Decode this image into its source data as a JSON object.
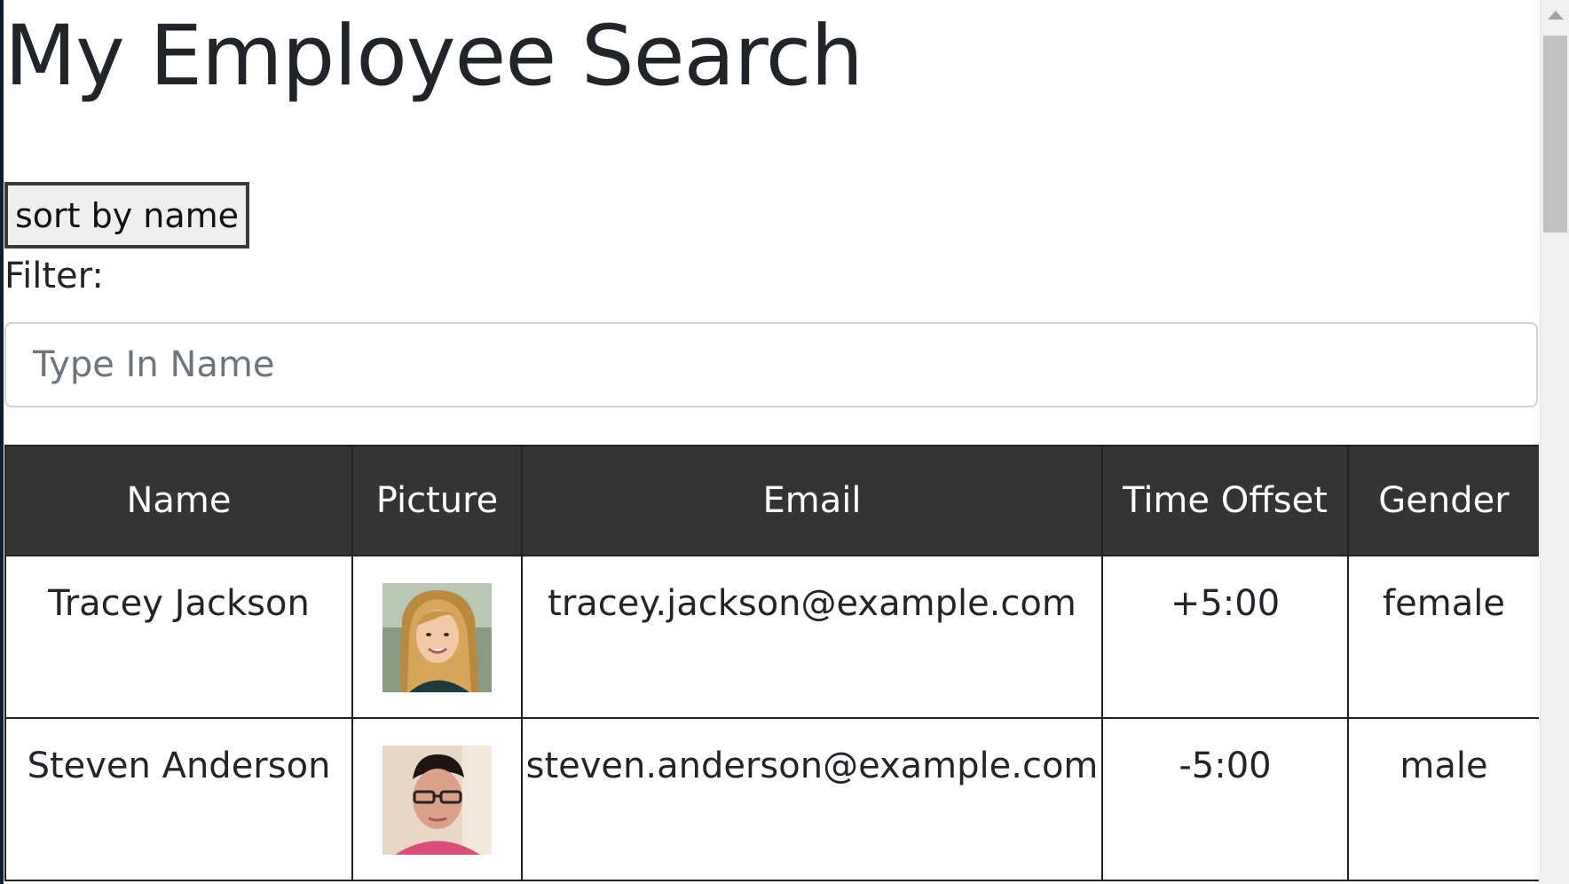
{
  "page": {
    "title": "My Employee Search"
  },
  "controls": {
    "sort_label": "sort by name",
    "filter_label": "Filter:",
    "search_placeholder": "Type In Name",
    "search_value": ""
  },
  "table": {
    "columns": [
      "Name",
      "Picture",
      "Email",
      "Time Offset",
      "Gender"
    ],
    "rows": [
      {
        "name": "Tracey Jackson",
        "picture": "portrait-woman-blonde",
        "email": "tracey.jackson@example.com",
        "time_offset": "+5:00",
        "gender": "female"
      },
      {
        "name": "Steven Anderson",
        "picture": "portrait-man-glasses",
        "email": "steven.anderson@example.com",
        "time_offset": "-5:00",
        "gender": "male"
      }
    ]
  },
  "colors": {
    "header_bg": "#343434",
    "header_text": "#ffffff",
    "text": "#212529"
  }
}
